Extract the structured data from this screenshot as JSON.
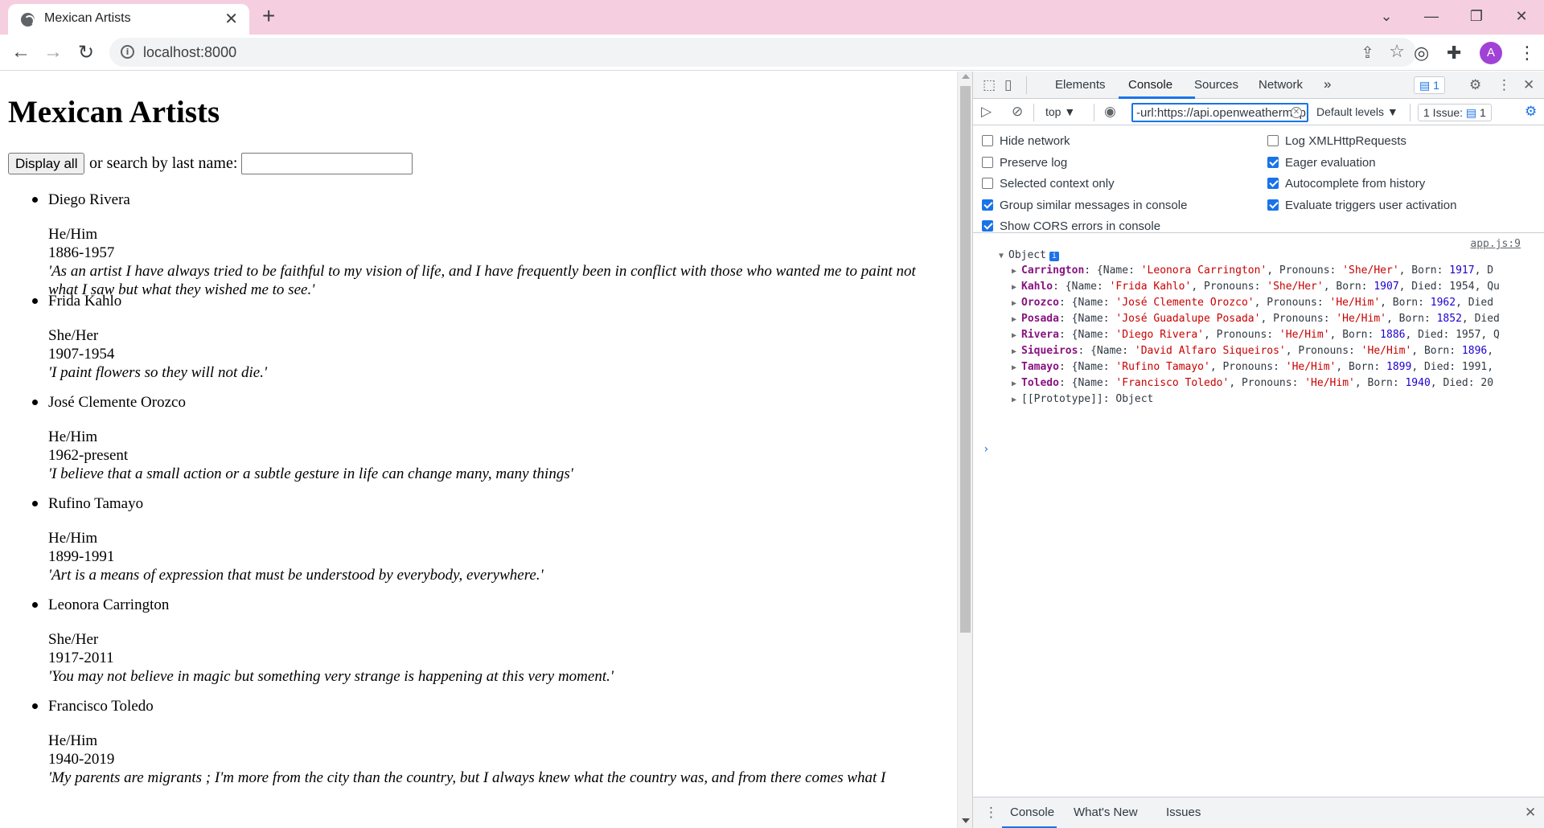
{
  "browser": {
    "tab_title": "Mexican Artists",
    "new_tab": "+",
    "url": "localhost:8000",
    "avatar_letter": "A",
    "icons": {
      "favicon": "globe-icon",
      "tab_close": "close-icon",
      "minimize": "minimize-icon",
      "maximize": "maximize-icon",
      "window_close": "close-icon",
      "back": "back-arrow-icon",
      "forward": "forward-arrow-icon",
      "reload": "reload-icon",
      "info": "info-icon",
      "share": "share-icon",
      "bookmark": "star-icon",
      "extension_a": "extension-icon",
      "extensions": "puzzle-icon",
      "menu": "kebab-menu-icon"
    }
  },
  "page": {
    "title": "Mexican Artists",
    "display_all_label": "Display all",
    "search_label": "or search by last name:",
    "search_value": "",
    "artists": [
      {
        "name": "Diego Rivera",
        "pronouns": "He/Him",
        "years": "1886-1957",
        "quote": "'As an artist I have always tried to be faithful to my vision of life, and I have frequently been in conflict with those who wanted me to paint not what I saw but what they wished me to see.'"
      },
      {
        "name": "Frida Kahlo",
        "pronouns": "She/Her",
        "years": "1907-1954",
        "quote": "'I paint flowers so they will not die.'"
      },
      {
        "name": "José Clemente Orozco",
        "pronouns": "He/Him",
        "years": "1962-present",
        "quote": "'I believe that a small action or a subtle gesture in life can change many, many things'"
      },
      {
        "name": "Rufino Tamayo",
        "pronouns": "He/Him",
        "years": "1899-1991",
        "quote": "'Art is a means of expression that must be understood by everybody, everywhere.'"
      },
      {
        "name": "Leonora Carrington",
        "pronouns": "She/Her",
        "years": "1917-2011",
        "quote": "'You may not believe in magic but something very strange is happening at this very moment.'"
      },
      {
        "name": "Francisco Toledo",
        "pronouns": "He/Him",
        "years": "1940-2019",
        "quote": "'My parents are migrants ; I'm more from the city than the country, but I always knew what the country was, and from there comes what I"
      }
    ]
  },
  "devtools": {
    "tabs": [
      "Elements",
      "Console",
      "Sources",
      "Network"
    ],
    "active_tab": "Console",
    "more_tabs": "»",
    "message_count": "1",
    "context": "top ▼",
    "filter_value": "-url:https://api.openweathermap.org",
    "levels": "Default levels ▼",
    "issues_label": "1 Issue:",
    "issues_count": "1",
    "settings_left": [
      {
        "label": "Hide network",
        "checked": false
      },
      {
        "label": "Preserve log",
        "checked": false
      },
      {
        "label": "Selected context only",
        "checked": false
      },
      {
        "label": "Group similar messages in console",
        "checked": true
      },
      {
        "label": "Show CORS errors in console",
        "checked": true
      }
    ],
    "settings_right": [
      {
        "label": "Log XMLHttpRequests",
        "checked": false
      },
      {
        "label": "Eager evaluation",
        "checked": true
      },
      {
        "label": "Autocomplete from history",
        "checked": true
      },
      {
        "label": "Evaluate triggers user activation",
        "checked": true
      }
    ],
    "source_link": "app.js:9",
    "object_label": "Object",
    "object_props": [
      {
        "key": "Carrington",
        "name": "'Leonora Carrington'",
        "pronouns": "'She/Her'",
        "born": "1917",
        "tail": ", D"
      },
      {
        "key": "Kahlo",
        "name": "'Frida Kahlo'",
        "pronouns": "'She/Her'",
        "born": "1907",
        "tail": ", Died: 1954, Qu"
      },
      {
        "key": "Orozco",
        "name": "'José Clemente Orozco'",
        "pronouns": "'He/Him'",
        "born": "1962",
        "tail": ", Died"
      },
      {
        "key": "Posada",
        "name": "'José Guadalupe Posada'",
        "pronouns": "'He/Him'",
        "born": "1852",
        "tail": ", Died"
      },
      {
        "key": "Rivera",
        "name": "'Diego Rivera'",
        "pronouns": "'He/Him'",
        "born": "1886",
        "tail": ", Died: 1957, Q"
      },
      {
        "key": "Siqueiros",
        "name": "'David Alfaro Siqueiros'",
        "pronouns": "'He/Him'",
        "born": "1896",
        "tail": ","
      },
      {
        "key": "Tamayo",
        "name": "'Rufino Tamayo'",
        "pronouns": "'He/Him'",
        "born": "1899",
        "tail": ", Died: 1991, "
      },
      {
        "key": "Toledo",
        "name": "'Francisco Toledo'",
        "pronouns": "'He/Him'",
        "born": "1940",
        "tail": ", Died: 20"
      }
    ],
    "prototype_label": "[[Prototype]]: Object",
    "prompt": "›",
    "drawer_tabs": [
      "Console",
      "What's New",
      "Issues"
    ]
  }
}
